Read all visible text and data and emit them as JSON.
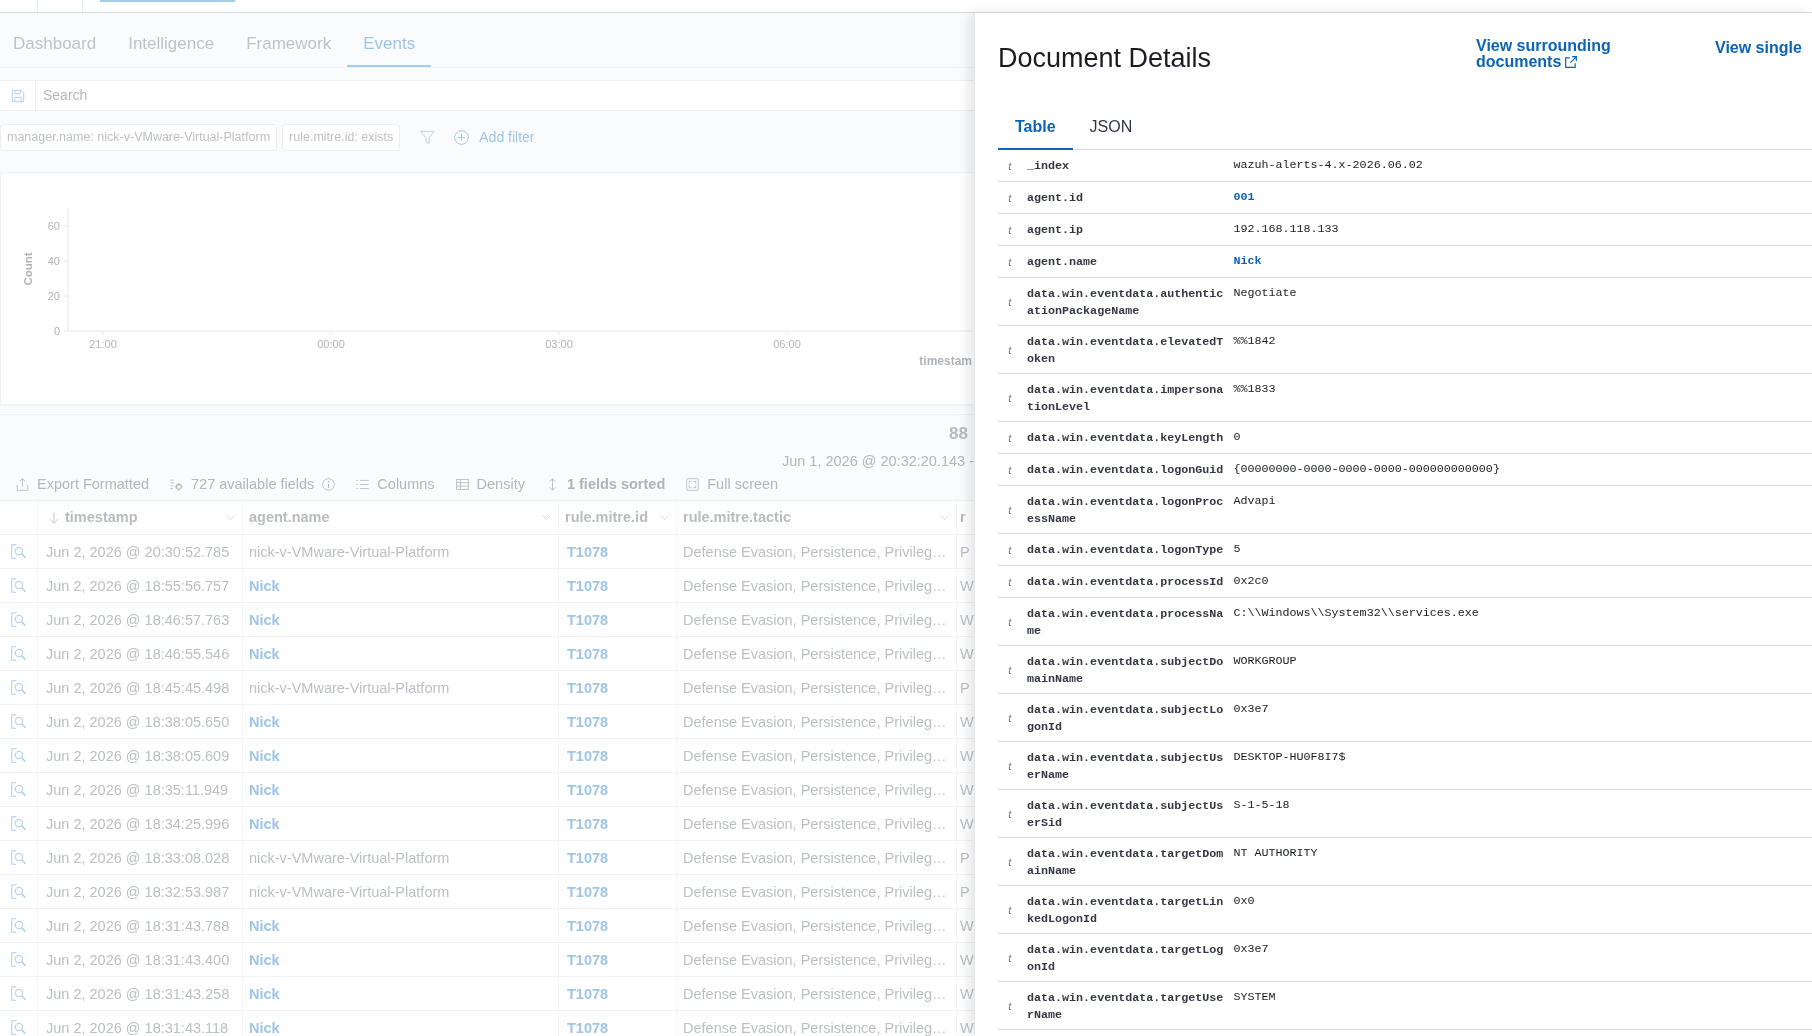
{
  "nav_tabs": [
    {
      "label": "Dashboard",
      "selected": false
    },
    {
      "label": "Intelligence",
      "selected": false
    },
    {
      "label": "Framework",
      "selected": false
    },
    {
      "label": "Events",
      "selected": true
    }
  ],
  "search": {
    "placeholder": "Search"
  },
  "filters": [
    {
      "label": "manager.name: nick-v-VMware-Virtual-Platform"
    },
    {
      "label": "rule.mitre.id: exists"
    }
  ],
  "add_filter": {
    "label": "Add filter"
  },
  "histogram": {
    "chart_data": {
      "type": "bar",
      "xlabel": "timestam",
      "ylabel": "Count",
      "categories": [
        "21:00",
        null,
        null,
        "00:00",
        null,
        null,
        "03:00",
        null,
        null,
        "06:00",
        null,
        null
      ],
      "ylim": [
        0,
        70
      ],
      "yticks": [
        0,
        20,
        40,
        60
      ]
    }
  },
  "hits": {
    "count": "88",
    "range": "Jun 1, 2026 @ 20:32:20.143 -"
  },
  "toolbar": [
    {
      "kind": "export",
      "label": "Export Formatted",
      "active": false
    },
    {
      "kind": "fields",
      "label": "727 available fields",
      "active": false
    },
    {
      "kind": "columns",
      "label": "Columns",
      "active": false
    },
    {
      "kind": "density",
      "label": "Density",
      "active": false
    },
    {
      "kind": "sort",
      "label": "1 fields sorted",
      "active": true
    },
    {
      "kind": "fullscreen",
      "label": "Full screen",
      "active": false
    }
  ],
  "table": {
    "columns": [
      {
        "label": "timestamp",
        "sorted": true,
        "menu": true
      },
      {
        "label": "agent.name",
        "sorted": false,
        "menu": true
      },
      {
        "label": "rule.mitre.id",
        "sorted": false,
        "menu": true
      },
      {
        "label": "rule.mitre.tactic",
        "sorted": false,
        "menu": true
      },
      {
        "label": "r",
        "sorted": false,
        "menu": false
      }
    ],
    "rows": [
      {
        "timestamp": "Jun 2, 2026 @ 20:30:52.785",
        "agent_name": "nick-v-VMware-Virtual-Platform",
        "agent_link": false,
        "rule_mitre_id": "T1078",
        "rule_mitre_tactic": "Defense Evasion, Persistence, Privileg…",
        "column_5": "P"
      },
      {
        "timestamp": "Jun 2, 2026 @ 18:55:56.757",
        "agent_name": "Nick",
        "agent_link": true,
        "rule_mitre_id": "T1078",
        "rule_mitre_tactic": "Defense Evasion, Persistence, Privileg…",
        "column_5": "W"
      },
      {
        "timestamp": "Jun 2, 2026 @ 18:46:57.763",
        "agent_name": "Nick",
        "agent_link": true,
        "rule_mitre_id": "T1078",
        "rule_mitre_tactic": "Defense Evasion, Persistence, Privileg…",
        "column_5": "W"
      },
      {
        "timestamp": "Jun 2, 2026 @ 18:46:55.546",
        "agent_name": "Nick",
        "agent_link": true,
        "rule_mitre_id": "T1078",
        "rule_mitre_tactic": "Defense Evasion, Persistence, Privileg…",
        "column_5": "W"
      },
      {
        "timestamp": "Jun 2, 2026 @ 18:45:45.498",
        "agent_name": "nick-v-VMware-Virtual-Platform",
        "agent_link": false,
        "rule_mitre_id": "T1078",
        "rule_mitre_tactic": "Defense Evasion, Persistence, Privileg…",
        "column_5": "P"
      },
      {
        "timestamp": "Jun 2, 2026 @ 18:38:05.650",
        "agent_name": "Nick",
        "agent_link": true,
        "rule_mitre_id": "T1078",
        "rule_mitre_tactic": "Defense Evasion, Persistence, Privileg…",
        "column_5": "W"
      },
      {
        "timestamp": "Jun 2, 2026 @ 18:38:05.609",
        "agent_name": "Nick",
        "agent_link": true,
        "rule_mitre_id": "T1078",
        "rule_mitre_tactic": "Defense Evasion, Persistence, Privileg…",
        "column_5": "W"
      },
      {
        "timestamp": "Jun 2, 2026 @ 18:35:11.949",
        "agent_name": "Nick",
        "agent_link": true,
        "rule_mitre_id": "T1078",
        "rule_mitre_tactic": "Defense Evasion, Persistence, Privileg…",
        "column_5": "W"
      },
      {
        "timestamp": "Jun 2, 2026 @ 18:34:25.996",
        "agent_name": "Nick",
        "agent_link": true,
        "rule_mitre_id": "T1078",
        "rule_mitre_tactic": "Defense Evasion, Persistence, Privileg…",
        "column_5": "W"
      },
      {
        "timestamp": "Jun 2, 2026 @ 18:33:08.028",
        "agent_name": "nick-v-VMware-Virtual-Platform",
        "agent_link": false,
        "rule_mitre_id": "T1078",
        "rule_mitre_tactic": "Defense Evasion, Persistence, Privileg…",
        "column_5": "P"
      },
      {
        "timestamp": "Jun 2, 2026 @ 18:32:53.987",
        "agent_name": "nick-v-VMware-Virtual-Platform",
        "agent_link": false,
        "rule_mitre_id": "T1078",
        "rule_mitre_tactic": "Defense Evasion, Persistence, Privileg…",
        "column_5": "P"
      },
      {
        "timestamp": "Jun 2, 2026 @ 18:31:43.788",
        "agent_name": "Nick",
        "agent_link": true,
        "rule_mitre_id": "T1078",
        "rule_mitre_tactic": "Defense Evasion, Persistence, Privileg…",
        "column_5": "W"
      },
      {
        "timestamp": "Jun 2, 2026 @ 18:31:43.400",
        "agent_name": "Nick",
        "agent_link": true,
        "rule_mitre_id": "T1078",
        "rule_mitre_tactic": "Defense Evasion, Persistence, Privileg…",
        "column_5": "W"
      },
      {
        "timestamp": "Jun 2, 2026 @ 18:31:43.258",
        "agent_name": "Nick",
        "agent_link": true,
        "rule_mitre_id": "T1078",
        "rule_mitre_tactic": "Defense Evasion, Persistence, Privileg…",
        "column_5": "W"
      },
      {
        "timestamp": "Jun 2, 2026 @ 18:31:43.118",
        "agent_name": "Nick",
        "agent_link": true,
        "rule_mitre_id": "T1078",
        "rule_mitre_tactic": "Defense Evasion, Persistence, Privileg…",
        "column_5": "W"
      }
    ]
  },
  "flyout": {
    "title": "Document Details",
    "links": [
      {
        "label": "View surrounding documents",
        "external": true
      },
      {
        "label": "View single",
        "external": false
      }
    ],
    "tabs": [
      {
        "label": "Table",
        "selected": true
      },
      {
        "label": "JSON",
        "selected": false
      }
    ],
    "fields": [
      {
        "type": "t",
        "name": "_index",
        "value": "wazuh-alerts-4.x-2026.06.02",
        "link": false
      },
      {
        "type": "t",
        "name": "agent.id",
        "value": "001",
        "link": true
      },
      {
        "type": "t",
        "name": "agent.ip",
        "value": "192.168.118.133",
        "link": false
      },
      {
        "type": "t",
        "name": "agent.name",
        "value": "Nick",
        "link": true
      },
      {
        "type": "t",
        "name": "data.win.eventdata.authenticationPackageName",
        "value": "Negotiate",
        "link": false
      },
      {
        "type": "t",
        "name": "data.win.eventdata.elevatedToken",
        "value": "%%1842",
        "link": false
      },
      {
        "type": "t",
        "name": "data.win.eventdata.impersonationLevel",
        "value": "%%1833",
        "link": false
      },
      {
        "type": "t",
        "name": "data.win.eventdata.keyLength",
        "value": "0",
        "link": false
      },
      {
        "type": "t",
        "name": "data.win.eventdata.logonGuid",
        "value": "{00000000-0000-0000-0000-000000000000}",
        "link": false
      },
      {
        "type": "t",
        "name": "data.win.eventdata.logonProcessName",
        "value": "Advapi",
        "link": false
      },
      {
        "type": "t",
        "name": "data.win.eventdata.logonType",
        "value": "5",
        "link": false
      },
      {
        "type": "t",
        "name": "data.win.eventdata.processId",
        "value": "0x2c0",
        "link": false
      },
      {
        "type": "t",
        "name": "data.win.eventdata.processName",
        "value": "C:\\\\Windows\\\\System32\\\\services.exe",
        "link": false
      },
      {
        "type": "t",
        "name": "data.win.eventdata.subjectDomainName",
        "value": "WORKGROUP",
        "link": false
      },
      {
        "type": "t",
        "name": "data.win.eventdata.subjectLogonId",
        "value": "0x3e7",
        "link": false
      },
      {
        "type": "t",
        "name": "data.win.eventdata.subjectUserName",
        "value": "DESKTOP-HU0F8I7$",
        "link": false
      },
      {
        "type": "t",
        "name": "data.win.eventdata.subjectUserSid",
        "value": "S-1-5-18",
        "link": false
      },
      {
        "type": "t",
        "name": "data.win.eventdata.targetDomainName",
        "value": "NT AUTHORITY",
        "link": false
      },
      {
        "type": "t",
        "name": "data.win.eventdata.targetLinkedLogonId",
        "value": "0x0",
        "link": false
      },
      {
        "type": "t",
        "name": "data.win.eventdata.targetLogonId",
        "value": "0x3e7",
        "link": false
      },
      {
        "type": "t",
        "name": "data.win.eventdata.targetUserName",
        "value": "SYSTEM",
        "link": false
      }
    ]
  }
}
